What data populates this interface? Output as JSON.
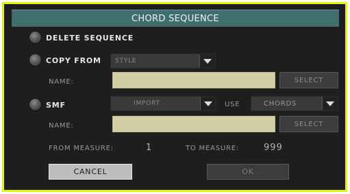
{
  "dialog": {
    "title": "CHORD SEQUENCE",
    "accent_border": "#e5f500",
    "title_bar_color": "#3f6e6e"
  },
  "options": {
    "delete_sequence": "DELETE SEQUENCE",
    "copy_from": "COPY FROM",
    "smf": "SMF"
  },
  "copy_from": {
    "source_value": "STYLE",
    "name_label": "NAME:",
    "name_value": "",
    "select_label": "SELECT"
  },
  "smf": {
    "mode_value": "IMPORT",
    "use_label": "USE",
    "use_value": "CHORDS",
    "name_label": "NAME:",
    "name_value": "",
    "select_label": "SELECT"
  },
  "measures": {
    "from_label": "FROM MEASURE:",
    "from_value": "1",
    "to_label": "TO MEASURE:",
    "to_value": "999"
  },
  "buttons": {
    "cancel": "CANCEL",
    "ok": "OK"
  },
  "icons": {
    "radio": "radio-button-icon",
    "dropdown": "dropdown-arrow-icon"
  }
}
